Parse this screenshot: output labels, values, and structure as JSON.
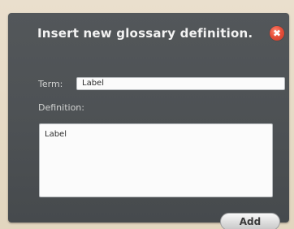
{
  "dialog": {
    "title": "Insert new glossary definition.",
    "close_glyph": "✖",
    "term_label": "Term:",
    "term_value": "Label",
    "definition_label": "Definition:",
    "definition_value": "Label",
    "add_label": "Add"
  },
  "colors": {
    "dialog_bg": "#4e5255",
    "close_button": "#e64f3a",
    "page_bg": "#e7ddc9"
  },
  "icons": {
    "close": "close-icon"
  }
}
